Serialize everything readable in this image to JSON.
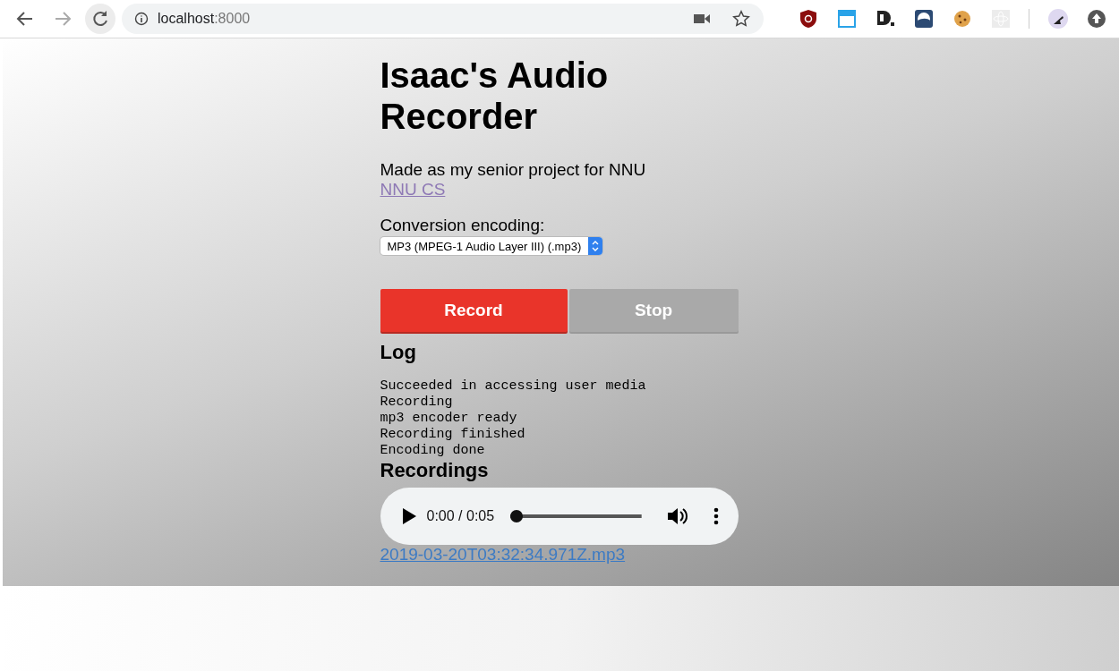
{
  "browser": {
    "address_host": "localhost",
    "address_port": ":8000"
  },
  "page": {
    "title": "Isaac's Audio Recorder",
    "subtitle": "Made as my senior project for NNU",
    "link": "NNU CS",
    "encoding_label": "Conversion encoding:",
    "encoding_value": "MP3 (MPEG-1 Audio Layer III) (.mp3)",
    "buttons": [
      {
        "kind": "record",
        "label": "Record",
        "disabled": false
      },
      {
        "kind": "stop",
        "label": "Stop",
        "disabled": true
      }
    ],
    "log_title": "Log",
    "log": [
      "Succeeded in accessing user media",
      "Recording",
      "mp3 encoder ready",
      "Recording finished",
      "Encoding done"
    ],
    "recordings_title": "Recordings",
    "player": {
      "time": "0:00 / 0:05",
      "level": 0
    },
    "recordings": [
      {
        "filename": "2019-03-20T03:32:34.971Z.mp3"
      }
    ]
  }
}
